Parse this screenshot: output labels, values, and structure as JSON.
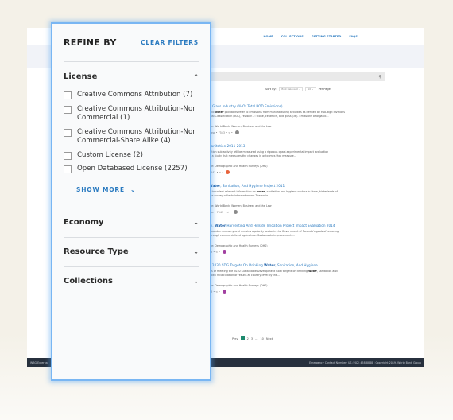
{
  "background_page": {
    "nav": [
      "HOME",
      "COLLECTIONS",
      "GETTING STARTED",
      "FAQS"
    ],
    "search": {
      "icon": "search-icon"
    },
    "sort": {
      "label": "Sort by:",
      "value": "Most Relevant",
      "per_page_value": "10",
      "per_page_label": "Per Page"
    },
    "results": [
      {
        "title_pre": "d Glass Industry (% Of Total BOD Emissions)",
        "title_bold": "",
        "title_post": "",
        "desc1_pre": "anic ",
        "desc1_bold": "water",
        "desc1_post": " pollutants refer to emissions from manufacturing activities as defined by two-digit divisions",
        "desc2": "trial Classification (ISIC), revision 2: stone, ceramics, and glass (36). Emissions of organic...",
        "source": "rce: World Bank, Women, Business and the Law",
        "meta": "view  •  7543  •  <  •",
        "badge_color": "#8a8a8a"
      },
      {
        "title_pre": "Sanitation 2011-2013",
        "title_bold": "",
        "title_post": "",
        "desc1_pre": "tation sub activity will be measured using a rigorous quasi-experimental impact evaluation",
        "desc1_bold": "",
        "desc1_post": "",
        "desc2": "is a study that measures the changes in outcomes that measure...",
        "source": "rce: Demographic and Health Surveys (DHS)",
        "meta": "7543  •  <  •",
        "badge_color": "#e8643c"
      },
      {
        "title_pre": "",
        "title_bold": "Water",
        "title_post": ", Sanitation, And Hygiene Project 2011",
        "desc1_pre": "is to collect relevant information on ",
        "desc1_bold": "water",
        "desc1_post": ", sanitation and hygiene sectors in Praia, hinterlands of",
        "desc2": "the survey collects information on: The socio...",
        "source": "rce: World Bank, Women, Business and the Law",
        "meta": "iew  •  7543  •  <  •",
        "badge_color": "#8a8a8a"
      },
      {
        "title_pre": "ry, ",
        "title_bold": "Water",
        "title_post": " Harvesting And Hillside Irrigation Project Impact Evaluation 2014",
        "desc1_pre": "Rwandan economy and remains a priority sector in the Government of Rwanda's goals of reducing",
        "desc1_bold": "",
        "desc1_post": "",
        "desc2": "through commercialized agriculture. Sustainable improvements...",
        "source": "rce: Demographic and Health Surveys (DHS)",
        "meta": "03  •  <  •",
        "badge_color": "#a23fa0"
      },
      {
        "title_pre": "e 2030 SDG Targets On Drinking ",
        "title_bold": "Water",
        "title_post": ", Sanitation, And Hygiene",
        "desc1_pre": "sts of meeting the 2030 Sustainable Development Goal targets on drinking ",
        "desc1_bold": "water",
        "desc1_post": ", sanitation and",
        "desc2": "down recalculation of results at country level by the...",
        "source": "rce: Demographic and Health Surveys (DHS)",
        "meta": "03  •  <  •",
        "badge_color": "#a23fa0"
      }
    ],
    "pagination": {
      "prev": "Prev",
      "current": "1",
      "pages": [
        "2",
        "3",
        "...",
        "10"
      ],
      "next": "Next"
    },
    "footer": {
      "left": "WBG External",
      "right": "Emergency Contact Number: US (202) 458-8888  |  Copyright 2019, World Bank Group"
    }
  },
  "refine_panel": {
    "title": "REFINE BY",
    "clear_label": "CLEAR FILTERS",
    "sections": [
      {
        "title": "License",
        "expanded": true,
        "options": [
          {
            "label": "Creative Commons Attribution (7)",
            "checked": false
          },
          {
            "label": "Creative Commons Attribution-Non Commercial (1)",
            "checked": false
          },
          {
            "label": "Creative Commons Attribution-Non Commercial-Share Alike (4)",
            "checked": false
          },
          {
            "label": "Custom License (2)",
            "checked": false
          },
          {
            "label": "Open Databased License (2257)",
            "checked": false
          }
        ],
        "show_more_label": "SHOW MORE"
      },
      {
        "title": "Economy",
        "expanded": false
      },
      {
        "title": "Resource Type",
        "expanded": false
      },
      {
        "title": "Collections",
        "expanded": false
      }
    ]
  },
  "icons": {
    "chevron_up": "⌃",
    "chevron_down": "⌄",
    "search": "⌕"
  }
}
